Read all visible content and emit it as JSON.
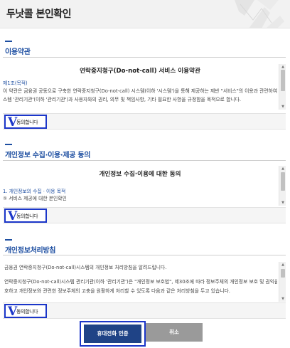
{
  "header": {
    "title": "두낫콜 본인확인"
  },
  "terms": {
    "section_title": "이용약관",
    "doc_title": "연락중지청구(Do-not-call) 서비스 이용약관",
    "article": "제1조(목적)",
    "body_line1": "이 약관은 금융권 공동으로 구축한 연락중지청구(Do-not-call) 시스템(이하 '시스템')을 통해 제공하는 제반 \"서비스\"의 이용과 관련하여, 시",
    "body_line2": "스템 '관리기관'(이하 '관리기관')과 사용자와의 권리, 의무 및 책임사항, 기타 필요한 사항을 규정함을 목적으로 합니다.",
    "agree_label": "동의합니다"
  },
  "privacy": {
    "section_title": "개인정보 수집·이용·제공 동의",
    "doc_title": "개인정보 수집·이용에 대한 동의",
    "item1": "1. 개인정보의 수집 · 이용 목적",
    "item1_detail": "① 서비스 제공에 대한 본인확인",
    "agree_label": "동의합니다"
  },
  "policy": {
    "section_title": "개인정보처리방침",
    "intro": "금융권 연락중지청구(Do-not-call)시스템의 개인정보 처리방침을 알려드립니다.",
    "body_line1": "연락중지청구(Do-not-call)시스템 관리기관(이하 '관리기관')은 \"개인정보 보호법\", 제30조에 따라 정보주체의 개인정보 보호 및 권익을 보",
    "body_line2": "호하고 개인정보와 관련한 정보주체의 고충을 원활하게 처리할 수 있도록 다음과 같은 처리방침을 두고 있습니다.",
    "agree_label": "동의합니다"
  },
  "agree_mark": "V",
  "buttons": {
    "phone_auth": "휴대전화 인증",
    "cancel": "취소"
  },
  "colors": {
    "accent": "#1d4ea1",
    "highlight": "#1b36c9",
    "primary_button": "#1f4386",
    "cancel_button": "#9a9a9a"
  }
}
